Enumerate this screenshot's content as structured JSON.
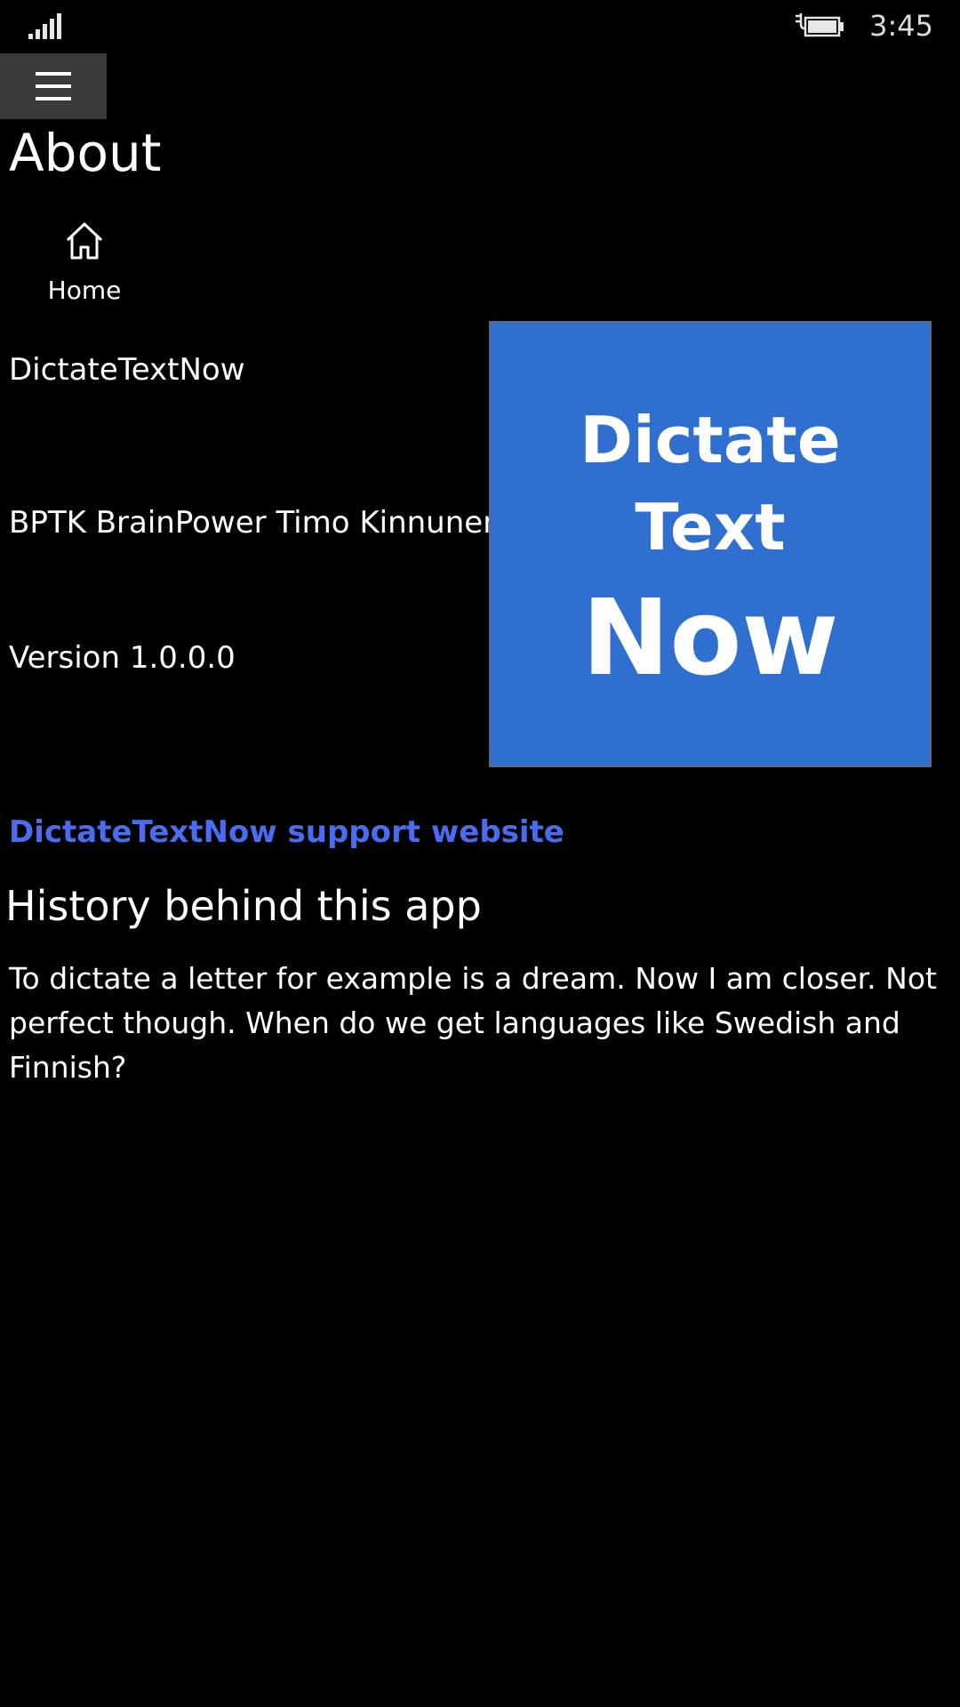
{
  "status_bar": {
    "time": "3:45",
    "signal_icon": "signal-bars-icon",
    "battery_icon": "battery-charging-icon"
  },
  "nav": {
    "menu_icon": "hamburger-menu-icon",
    "home_icon": "home-icon",
    "home_label": "Home"
  },
  "page": {
    "title": "About"
  },
  "app_info": {
    "name": "DictateTextNow",
    "publisher": "BPTK BrainPower Timo Kinnunen",
    "version": "Version 1.0.0.0"
  },
  "logo": {
    "line1": "Dictate",
    "line2": "Text",
    "line3": "Now",
    "background_color": "#2f6fd0"
  },
  "support": {
    "link_label": "DictateTextNow support website",
    "link_color": "#4a6cf0"
  },
  "history": {
    "heading": "History behind this app",
    "text": "To dictate a letter for example is a dream. Now I am closer. Not perfect though. When do we get languages like Swedish and Finnish?"
  }
}
